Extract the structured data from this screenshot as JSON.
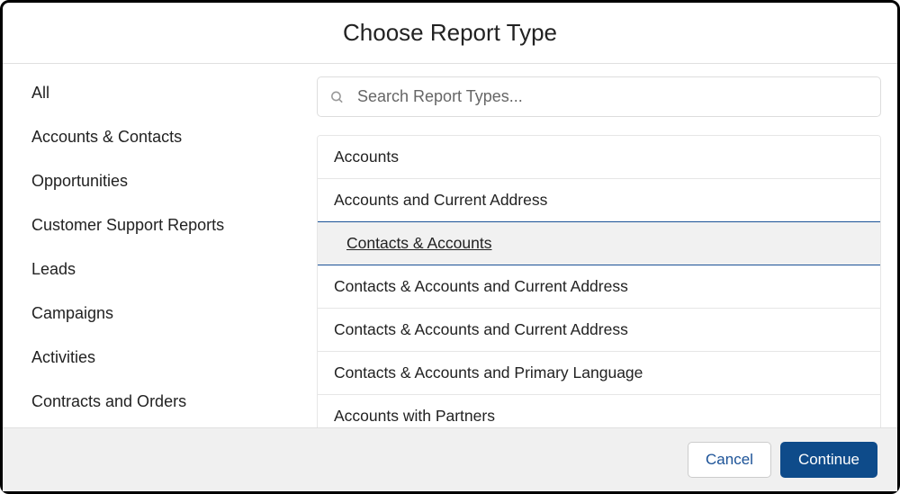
{
  "header": {
    "title": "Choose Report Type"
  },
  "sidebar": {
    "items": [
      {
        "label": "All"
      },
      {
        "label": "Accounts & Contacts"
      },
      {
        "label": "Opportunities"
      },
      {
        "label": "Customer Support Reports"
      },
      {
        "label": "Leads"
      },
      {
        "label": "Campaigns"
      },
      {
        "label": "Activities"
      },
      {
        "label": "Contracts and Orders"
      }
    ]
  },
  "search": {
    "placeholder": "Search Report Types..."
  },
  "reports": {
    "items": [
      {
        "label": "Accounts",
        "selected": false
      },
      {
        "label": "Accounts and Current Address",
        "selected": false
      },
      {
        "label": "Contacts & Accounts",
        "selected": true
      },
      {
        "label": "Contacts & Accounts and Current Address",
        "selected": false
      },
      {
        "label": "Contacts & Accounts and Current Address",
        "selected": false
      },
      {
        "label": "Contacts & Accounts and Primary Language",
        "selected": false
      },
      {
        "label": "Accounts with Partners",
        "selected": false
      }
    ]
  },
  "footer": {
    "cancel_label": "Cancel",
    "continue_label": "Continue"
  }
}
